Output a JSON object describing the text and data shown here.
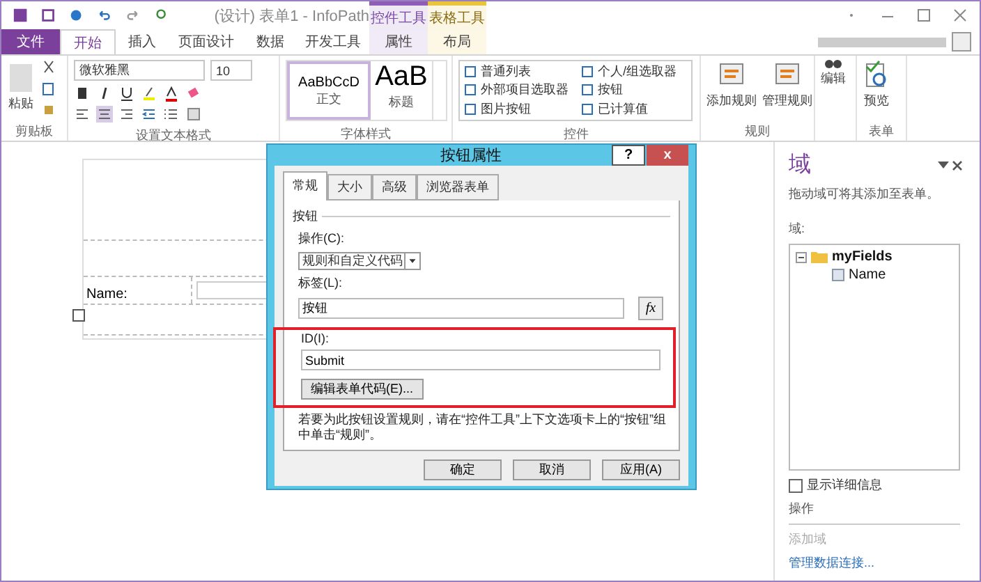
{
  "window": {
    "title": "(设计) 表单1 - InfoPath",
    "context_groups": [
      {
        "label": "控件工具",
        "color": "#8e5fb5"
      },
      {
        "label": "表格工具",
        "color": "#e8c53a"
      }
    ]
  },
  "tabs": [
    {
      "label": "文件",
      "selected": false,
      "kind": "file"
    },
    {
      "label": "开始",
      "selected": true,
      "kind": "plain"
    },
    {
      "label": "插入",
      "selected": false,
      "kind": "plain"
    },
    {
      "label": "页面设计",
      "selected": false,
      "kind": "plain"
    },
    {
      "label": "数据",
      "selected": false,
      "kind": "plain"
    },
    {
      "label": "开发工具",
      "selected": false,
      "kind": "plain"
    },
    {
      "label": "属性",
      "selected": false,
      "kind": "context0"
    },
    {
      "label": "布局",
      "selected": false,
      "kind": "context1"
    }
  ],
  "ribbon": {
    "paste": "粘贴",
    "font_name": "微软雅黑",
    "font_size": "10",
    "styles": [
      {
        "sample": "AaBbCcD",
        "label": "正文",
        "selected": true
      },
      {
        "sample": "AaB",
        "label": "标题",
        "selected": false
      }
    ],
    "controls": [
      "普通列表",
      "个人/组选取器",
      "外部项目选取器",
      "按钮",
      "图片按钮",
      "已计算值"
    ],
    "rules": [
      "添加规则",
      "管理规则"
    ],
    "edit": "编辑",
    "preview": "预览",
    "groups": [
      "剪贴板",
      "设置文本格式",
      "字体样式",
      "控件",
      "规则",
      "表单"
    ]
  },
  "form": {
    "name_label": "Name:"
  },
  "dialog": {
    "title": "按钮属性",
    "help": "?",
    "close": "x",
    "tabs": [
      {
        "label": "常规",
        "selected": true
      },
      {
        "label": "大小",
        "selected": false
      },
      {
        "label": "高级",
        "selected": false
      },
      {
        "label": "浏览器表单",
        "selected": false
      }
    ],
    "section": "按钮",
    "action_label": "操作(C):",
    "action_value": "规则和自定义代码",
    "caption_label": "标签(L):",
    "caption_value": "按钮",
    "fx": "fx",
    "id_label": "ID(I):",
    "id_value": "Submit",
    "edit_code": "编辑表单代码(E)...",
    "note": "若要为此按钮设置规则，请在“控件工具”上下文选项卡上的“按钮”组中单击“规则”。",
    "buttons": [
      "确定",
      "取消",
      "应用(A)"
    ]
  },
  "pane": {
    "title": "域",
    "hint": "拖动域可将其添加至表单。",
    "tree_label": "域:",
    "tree": [
      {
        "label": "myFields",
        "expanded": true,
        "children": [
          {
            "label": "Name"
          }
        ]
      }
    ],
    "details": {
      "label": "显示详细信息",
      "checked": false
    },
    "actions_label": "操作",
    "add_field": {
      "label": "添加域",
      "disabled": true
    },
    "manage_link": "管理数据连接..."
  }
}
